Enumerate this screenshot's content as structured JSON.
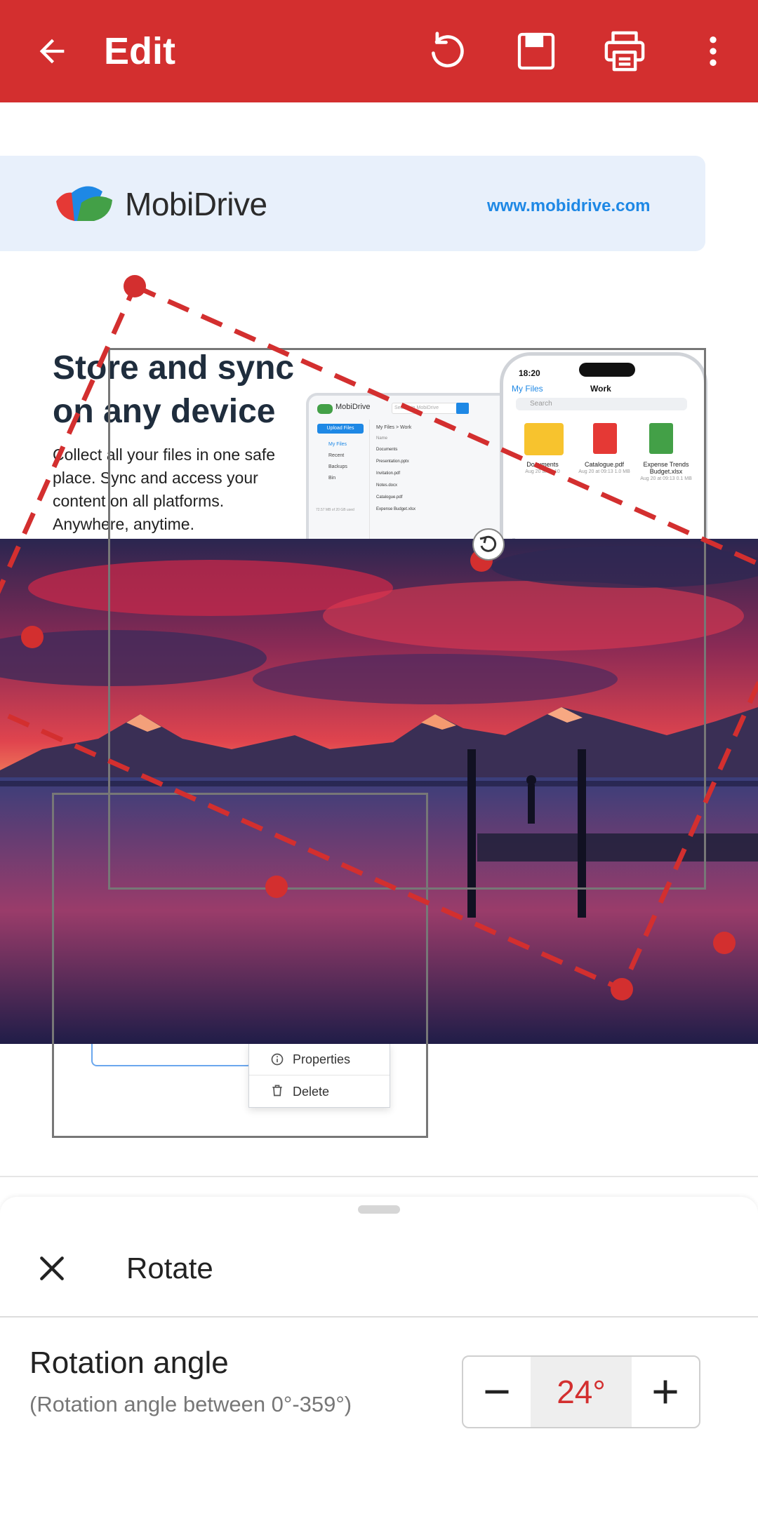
{
  "app_bar": {
    "title": "Edit",
    "back_icon": "arrow-left-icon",
    "undo_icon": "undo-icon",
    "save_icon": "save-icon",
    "print_icon": "print-icon",
    "more_icon": "more-vert-icon",
    "color": "#d32f2f"
  },
  "document": {
    "brand": "MobiDrive",
    "url": "www.mobidrive.com",
    "headline": "Store and sync on any device",
    "subtext": "Collect all your files in one safe place. Sync and access your content on all platforms. Anywhere, anytime.",
    "laptop": {
      "brand": "MobiDrive",
      "search": "Search in MobiDrive",
      "upload": "Upload Files",
      "nav": [
        "My Files",
        "Recent",
        "Backups",
        "Bin"
      ],
      "breadcrumb": "My Files > Work",
      "column": "Name",
      "files": [
        "Documents",
        "Presentation.pptx",
        "Invitation.pdf",
        "Notes.docx",
        "Catalogue.pdf",
        "Expense Budget.xlsx"
      ],
      "storage": "72.57 MB of 20 GB used"
    },
    "phone": {
      "time": "18:20",
      "back": "My Files",
      "folder": "Work",
      "search": "Search",
      "items": [
        {
          "name": "Documents",
          "meta": "Aug 20 at 09:10"
        },
        {
          "name": "Catalogue.pdf",
          "meta": "Aug 20 at 09:13 1.0 MB"
        },
        {
          "name": "Expense Trends Budget.xlsx",
          "meta": "Aug 20 at 09:13 0.1 MB"
        }
      ]
    },
    "context_menu": [
      "Properties",
      "Delete"
    ],
    "context_icons": [
      "info-icon",
      "trash-icon"
    ],
    "photo_subject": "sunset lake with mountains and pier",
    "rotate_handle_icon": "rotate-handle-icon"
  },
  "bottom_sheet": {
    "title": "Rotate",
    "close_icon": "close-icon",
    "field_label": "Rotation angle",
    "field_hint": "(Rotation angle between 0°-359°)",
    "minus_icon": "minus-icon",
    "plus_icon": "plus-icon",
    "value": "24°",
    "rotation_degrees": 24,
    "accent": "#d32f2f"
  }
}
